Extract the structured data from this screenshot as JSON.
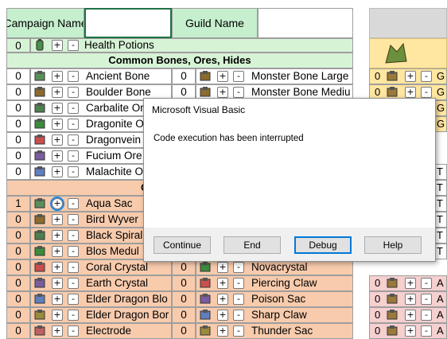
{
  "sheet": {
    "header": {
      "campaign_label": "Campaign Name",
      "guild_label": "Guild Name"
    },
    "health_row": {
      "qty": "0",
      "label": "Health Potions"
    },
    "section_common": "Common Bones, Ores, Hides",
    "section_c_partial": "C",
    "left_column": [
      {
        "qty": "0",
        "label": "Ancient Bone"
      },
      {
        "qty": "0",
        "label": "Boulder Bone"
      },
      {
        "qty": "0",
        "label": "Carbalite Or"
      },
      {
        "qty": "0",
        "label": "Dragonite Or"
      },
      {
        "qty": "0",
        "label": "Dragonvein"
      },
      {
        "qty": "0",
        "label": "Fucium Ore"
      },
      {
        "qty": "0",
        "label": "Malachite O"
      }
    ],
    "middle_column": [
      {
        "qty": "0",
        "label": "Monster Bone Large"
      },
      {
        "qty": "0",
        "label": "Monster Bone Mediu"
      }
    ],
    "left_column_2": [
      {
        "qty": "1",
        "label": "Aqua Sac"
      },
      {
        "qty": "0",
        "label": "Bird Wyver"
      },
      {
        "qty": "0",
        "label": "Black Spiral"
      },
      {
        "qty": "0",
        "label": "Blos Medul"
      },
      {
        "qty": "0",
        "label": "Coral Crystal"
      },
      {
        "qty": "0",
        "label": "Earth Crystal"
      },
      {
        "qty": "0",
        "label": "Elder Dragon Blo"
      },
      {
        "qty": "0",
        "label": "Elder Dragon Bor"
      },
      {
        "qty": "0",
        "label": "Electrode"
      }
    ],
    "middle_column_2": [
      {
        "qty": "0",
        "label": "Novacrystal"
      },
      {
        "qty": "0",
        "label": "Piercing Claw"
      },
      {
        "qty": "0",
        "label": "Poison Sac"
      },
      {
        "qty": "0",
        "label": "Sharp Claw"
      },
      {
        "qty": "0",
        "label": "Thunder Sac"
      }
    ],
    "right_partial_top": [
      "G",
      "G",
      "G",
      "G"
    ],
    "right_partial_mid": [
      "T",
      "T",
      "T",
      "T",
      "T",
      "T"
    ],
    "right_partial_bottom": [
      "A",
      "A",
      "A",
      "A"
    ],
    "right_qty_top": [
      "0",
      "0",
      "0",
      "0"
    ],
    "right_qty_bottom": [
      "0",
      "0",
      "0",
      "0"
    ],
    "plus": "+",
    "minus": "-"
  },
  "dialog": {
    "title": "Microsoft Visual Basic",
    "message": "Code execution has been interrupted",
    "buttons": {
      "continue": "Continue",
      "end": "End",
      "debug": "Debug",
      "help": "Help"
    }
  }
}
